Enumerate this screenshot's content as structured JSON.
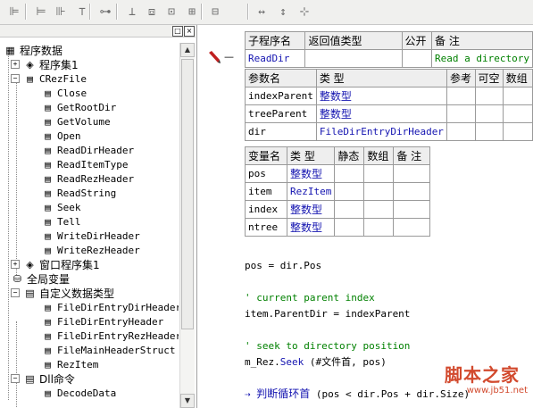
{
  "toolbar": {
    "buttons": [
      {
        "icon": "align-left-icon",
        "glyph": "⊫"
      },
      {
        "icon": "align-center-icon",
        "glyph": "⊨"
      },
      {
        "icon": "align-right-icon",
        "glyph": "⊪"
      },
      {
        "icon": "align-top-icon",
        "glyph": "⊤"
      },
      {
        "icon": "align-middle-icon",
        "glyph": "⊶"
      },
      {
        "icon": "align-bottom-icon",
        "glyph": "⊥"
      },
      {
        "icon": "center-horizontal-icon",
        "glyph": "⧈"
      },
      {
        "icon": "center-vertical-icon",
        "glyph": "⊡"
      },
      {
        "icon": "space-horizontal-icon",
        "glyph": "⊞"
      },
      {
        "icon": "space-vertical-icon",
        "glyph": "⊟"
      },
      {
        "icon": "same-width-icon",
        "glyph": "↔"
      },
      {
        "icon": "same-height-icon",
        "glyph": "↕"
      },
      {
        "icon": "same-size-icon",
        "glyph": "⊹"
      }
    ]
  },
  "tree": {
    "header_buttons": [
      "□",
      "×"
    ],
    "nodes": [
      {
        "label": "程序数据",
        "name": "tree-root-program-data",
        "icon": "program-data-icon",
        "glyph": "▦",
        "expander": "",
        "indent": 0,
        "mono": false
      },
      {
        "label": "程序集1",
        "name": "tree-assembly-1",
        "icon": "assembly-icon",
        "glyph": "◈",
        "expander": "+",
        "indent": 1,
        "mono": false
      },
      {
        "label": "CRezFile",
        "name": "tree-crezfile",
        "icon": "class-module-icon",
        "glyph": "▤",
        "expander": "−",
        "indent": 1,
        "mono": true
      },
      {
        "label": "Close",
        "name": "tree-method-close",
        "icon": "method-icon",
        "glyph": "▤",
        "expander": "",
        "indent": 2,
        "mono": true
      },
      {
        "label": "GetRootDir",
        "name": "tree-method-getrootdir",
        "icon": "method-icon",
        "glyph": "▤",
        "expander": "",
        "indent": 2,
        "mono": true
      },
      {
        "label": "GetVolume",
        "name": "tree-method-getvolume",
        "icon": "method-icon",
        "glyph": "▤",
        "expander": "",
        "indent": 2,
        "mono": true
      },
      {
        "label": "Open",
        "name": "tree-method-open",
        "icon": "method-icon",
        "glyph": "▤",
        "expander": "",
        "indent": 2,
        "mono": true
      },
      {
        "label": "ReadDirHeader",
        "name": "tree-method-readdirheader",
        "icon": "method-icon",
        "glyph": "▤",
        "expander": "",
        "indent": 2,
        "mono": true
      },
      {
        "label": "ReadItemType",
        "name": "tree-method-readitemtype",
        "icon": "method-icon",
        "glyph": "▤",
        "expander": "",
        "indent": 2,
        "mono": true
      },
      {
        "label": "ReadRezHeader",
        "name": "tree-method-readrezheader",
        "icon": "method-icon",
        "glyph": "▤",
        "expander": "",
        "indent": 2,
        "mono": true
      },
      {
        "label": "ReadString",
        "name": "tree-method-readstring",
        "icon": "method-icon",
        "glyph": "▤",
        "expander": "",
        "indent": 2,
        "mono": true
      },
      {
        "label": "Seek",
        "name": "tree-method-seek",
        "icon": "method-icon",
        "glyph": "▤",
        "expander": "",
        "indent": 2,
        "mono": true
      },
      {
        "label": "Tell",
        "name": "tree-method-tell",
        "icon": "method-icon",
        "glyph": "▤",
        "expander": "",
        "indent": 2,
        "mono": true
      },
      {
        "label": "WriteDirHeader",
        "name": "tree-method-writedirheader",
        "icon": "method-icon",
        "glyph": "▤",
        "expander": "",
        "indent": 2,
        "mono": true
      },
      {
        "label": "WriteRezHeader",
        "name": "tree-method-writerezheader",
        "icon": "method-icon",
        "glyph": "▤",
        "expander": "",
        "indent": 2,
        "mono": true
      },
      {
        "label": "窗口程序集1",
        "name": "tree-window-assembly-1",
        "icon": "assembly-icon",
        "glyph": "◈",
        "expander": "+",
        "indent": 1,
        "mono": false
      },
      {
        "label": "全局变量",
        "name": "tree-global-variables",
        "icon": "database-icon",
        "glyph": "⛁",
        "expander": "",
        "indent": 1,
        "mono": false
      },
      {
        "label": "自定义数据类型",
        "name": "tree-custom-data-types",
        "icon": "data-type-icon",
        "glyph": "▤",
        "expander": "−",
        "indent": 1,
        "mono": false
      },
      {
        "label": "FileDirEntryDirHeader",
        "name": "tree-type-filedirentrydirheader",
        "icon": "struct-icon",
        "glyph": "▤",
        "expander": "",
        "indent": 2,
        "mono": true
      },
      {
        "label": "FileDirEntryHeader",
        "name": "tree-type-filedirentryheader",
        "icon": "struct-icon",
        "glyph": "▤",
        "expander": "",
        "indent": 2,
        "mono": true
      },
      {
        "label": "FileDirEntryRezHeader",
        "name": "tree-type-filedirentryrezheader",
        "icon": "struct-icon",
        "glyph": "▤",
        "expander": "",
        "indent": 2,
        "mono": true
      },
      {
        "label": "FileMainHeaderStruct",
        "name": "tree-type-filemainheaderstruct",
        "icon": "struct-icon",
        "glyph": "▤",
        "expander": "",
        "indent": 2,
        "mono": true
      },
      {
        "label": "RezItem",
        "name": "tree-type-rezitem",
        "icon": "struct-icon",
        "glyph": "▤",
        "expander": "",
        "indent": 2,
        "mono": true
      },
      {
        "label": "Dll命令",
        "name": "tree-dll-commands",
        "icon": "dll-icon",
        "glyph": "▤",
        "expander": "−",
        "indent": 1,
        "mono": false
      },
      {
        "label": "DecodeData",
        "name": "tree-dll-decodedata",
        "icon": "dll-command-icon",
        "glyph": "▤",
        "expander": "",
        "indent": 2,
        "mono": true
      }
    ]
  },
  "sub_table": {
    "headers": [
      "子程序名",
      "返回值类型",
      "公开",
      "备 注"
    ],
    "row": {
      "name": "ReadDir",
      "return_type": "",
      "public": "",
      "note": "Read a directory"
    }
  },
  "param_table": {
    "headers": [
      "参数名",
      "类 型",
      "参考",
      "可空",
      "数组"
    ],
    "rows": [
      {
        "name": "indexParent",
        "type": "整数型"
      },
      {
        "name": "treeParent",
        "type": "整数型"
      },
      {
        "name": "dir",
        "type": "FileDirEntryDirHeader"
      }
    ]
  },
  "var_table": {
    "headers": [
      "变量名",
      "类 型",
      "静态",
      "数组",
      "备 注"
    ],
    "rows": [
      {
        "name": "pos",
        "type": "整数型"
      },
      {
        "name": "item",
        "type": "RezItem"
      },
      {
        "name": "index",
        "type": "整数型"
      },
      {
        "name": "ntree",
        "type": "整数型"
      }
    ]
  },
  "code": {
    "line1": "pos = dir.Pos",
    "comment1": "' current parent index",
    "line2": "item.ParentDir = indexParent",
    "comment2": "' seek to directory position",
    "line3_pre": "m_Rez.",
    "line3_kw": "Seek",
    "line3_post": " (#文件首, pos)",
    "line4_kw": "判断循环首",
    "line4_post": " (pos < dir.Pos + dir.Size)"
  },
  "gutter": {
    "marker": "—"
  },
  "watermark": {
    "title": "脚本之家",
    "url": "www.jb51.net"
  }
}
